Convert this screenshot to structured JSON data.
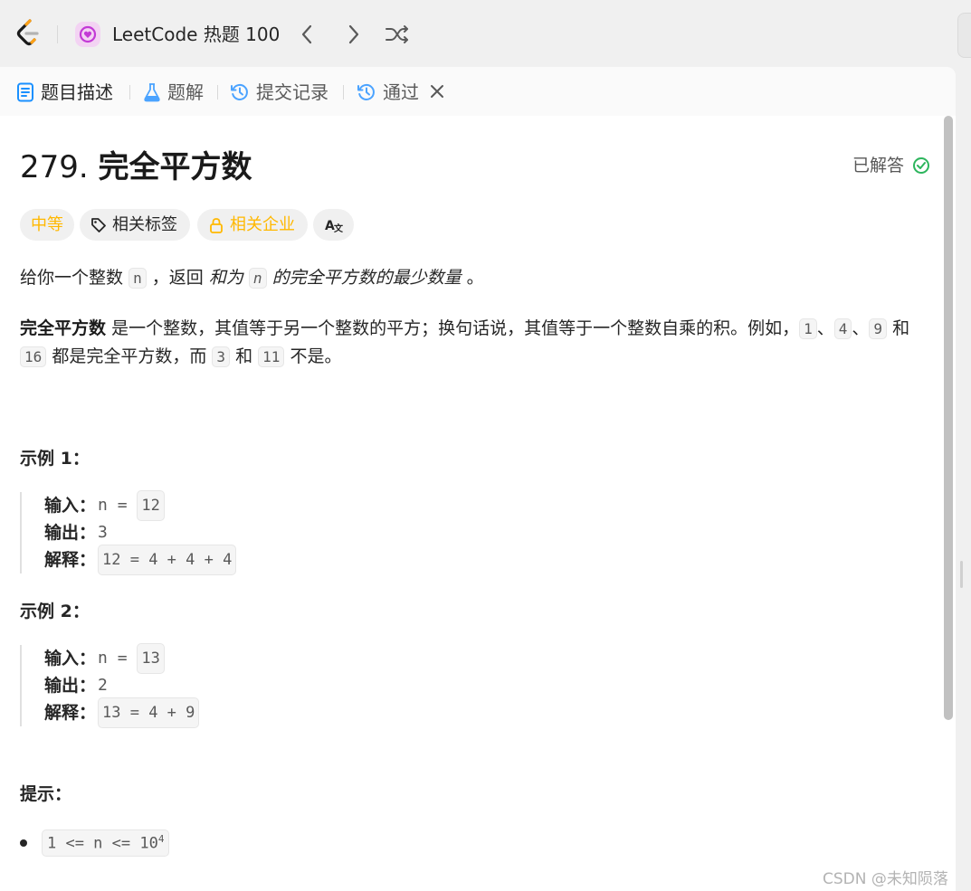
{
  "header": {
    "list_title": "LeetCode 热题 100",
    "icons": [
      "leetcode-logo",
      "study-plan-icon",
      "chevron-left-icon",
      "chevron-right-icon",
      "shuffle-icon"
    ]
  },
  "tabs": [
    {
      "label": "题目描述",
      "icon": "description-icon",
      "active": true
    },
    {
      "label": "题解",
      "icon": "flask-icon"
    },
    {
      "label": "提交记录",
      "icon": "history-icon"
    },
    {
      "label": "通过",
      "icon": "history-icon",
      "closable": true
    }
  ],
  "problem": {
    "number": "279.",
    "name": "完全平方数",
    "status": "已解答",
    "difficulty": "中等",
    "tags_label": "相关标签",
    "companies_label": "相关企业",
    "translate_label": "A文",
    "p1": {
      "a": "给你一个整数",
      "n": "n",
      "b": "，返回",
      "c": "和为",
      "n2": "n",
      "d": "的完全平方数的最少数量",
      "e": "。"
    },
    "p2": {
      "bold": "完全平方数",
      "a": "是一个整数，其值等于另一个整数的平方；换句话说，其值等于一个整数自乘的积。例如，",
      "c1": "1",
      "s1": "、",
      "c4": "4",
      "s2": "、",
      "c9": "9",
      "and1": "和",
      "c16": "16",
      "b": "都是完全平方数，而",
      "c3": "3",
      "and2": "和",
      "c11": "11",
      "c": "不是。"
    }
  },
  "examples": [
    {
      "title": "示例 1：",
      "input_label": "输入：",
      "input_val": "n = ",
      "input_code": "12",
      "output_label": "输出：",
      "output_val": "3",
      "explain_label": "解释：",
      "explain_code": "12 = 4 + 4 + 4"
    },
    {
      "title": "示例 2：",
      "input_label": "输入：",
      "input_val": "n = ",
      "input_code": "13",
      "output_label": "输出：",
      "output_val": "2",
      "explain_label": "解释：",
      "explain_code": "13 = 4 + 9"
    }
  ],
  "hints": {
    "title": "提示：",
    "item_base": "1 <= n <= 10",
    "item_exp": "4"
  },
  "watermark": "CSDN @未知陨落",
  "colors": {
    "difficulty_medium": "#ffb800",
    "solved_green": "#2db55d",
    "tab_icon_blue": "#1a90ff"
  }
}
